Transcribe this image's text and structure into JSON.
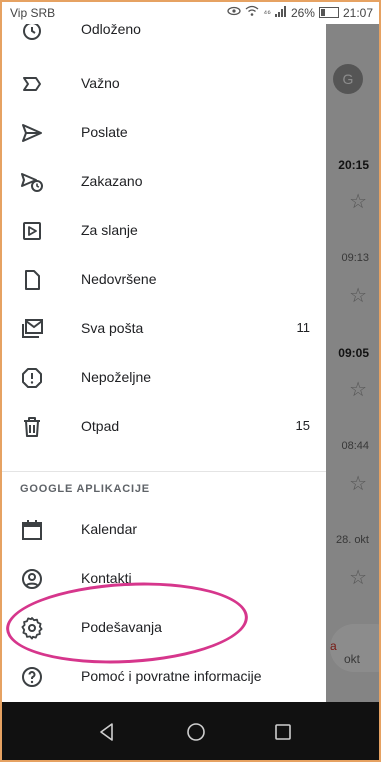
{
  "status_bar": {
    "carrier": "Vip SRB",
    "signal_text": "⁴⁶",
    "battery": "26%",
    "time": "21:07"
  },
  "drawer": {
    "partial_top_label": "Odloženo",
    "items": [
      {
        "label": "Važno",
        "icon": "important-icon"
      },
      {
        "label": "Poslate",
        "icon": "send-icon"
      },
      {
        "label": "Zakazano",
        "icon": "scheduled-icon"
      },
      {
        "label": "Za slanje",
        "icon": "outbox-icon"
      },
      {
        "label": "Nedovršene",
        "icon": "draft-icon"
      },
      {
        "label": "Sva pošta",
        "icon": "all-mail-icon",
        "count": "11"
      },
      {
        "label": "Nepoželjne",
        "icon": "spam-icon"
      },
      {
        "label": "Otpad",
        "icon": "trash-icon",
        "count": "15"
      }
    ],
    "section_header": "GOOGLE APLIKACIJE",
    "apps": [
      {
        "label": "Kalendar",
        "icon": "calendar-icon"
      },
      {
        "label": "Kontakti",
        "icon": "contacts-icon"
      }
    ],
    "settings": {
      "label": "Podešavanja",
      "icon": "settings-icon"
    },
    "help": {
      "label": "Pomoć i povratne informacije",
      "icon": "help-icon"
    }
  },
  "background": {
    "avatar_letter": "G",
    "times": [
      "20:15",
      "09:13",
      "09:05",
      "08:44",
      "28. okt"
    ],
    "fab_text": "okt",
    "fab_red": "a"
  },
  "colors": {
    "annotation": "#d6368c",
    "frame": "#e6a262",
    "navbar": "#111111"
  }
}
